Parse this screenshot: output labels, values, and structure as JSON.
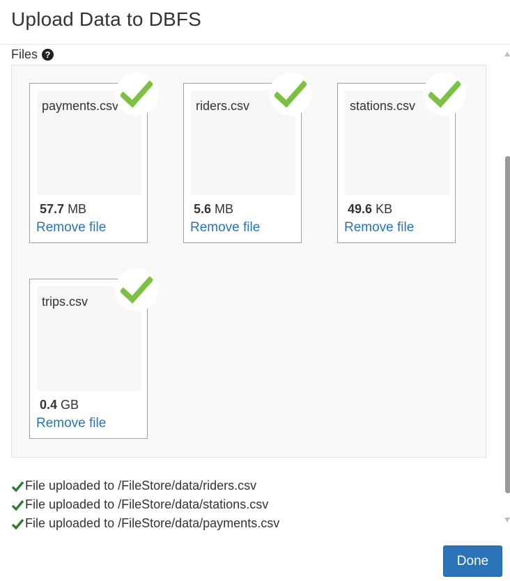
{
  "dialog": {
    "title": "Upload Data to DBFS"
  },
  "files_section": {
    "label": "Files",
    "help_icon": "question-circle-icon"
  },
  "files": [
    {
      "name": "payments.csv",
      "size_value": "57.7",
      "size_unit": "MB",
      "remove_label": "Remove file",
      "status": "uploaded"
    },
    {
      "name": "riders.csv",
      "size_value": "5.6",
      "size_unit": "MB",
      "remove_label": "Remove file",
      "status": "uploaded"
    },
    {
      "name": "stations.csv",
      "size_value": "49.6",
      "size_unit": "KB",
      "remove_label": "Remove file",
      "status": "uploaded"
    },
    {
      "name": "trips.csv",
      "size_value": "0.4",
      "size_unit": "GB",
      "remove_label": "Remove file",
      "status": "uploaded"
    }
  ],
  "status_messages": [
    "File uploaded to /FileStore/data/riders.csv",
    "File uploaded to /FileStore/data/stations.csv",
    "File uploaded to /FileStore/data/payments.csv"
  ],
  "footer": {
    "done_label": "Done"
  },
  "colors": {
    "accent": "#2a73b8",
    "success_check": "#7cc142",
    "status_check": "#2e7d32"
  }
}
